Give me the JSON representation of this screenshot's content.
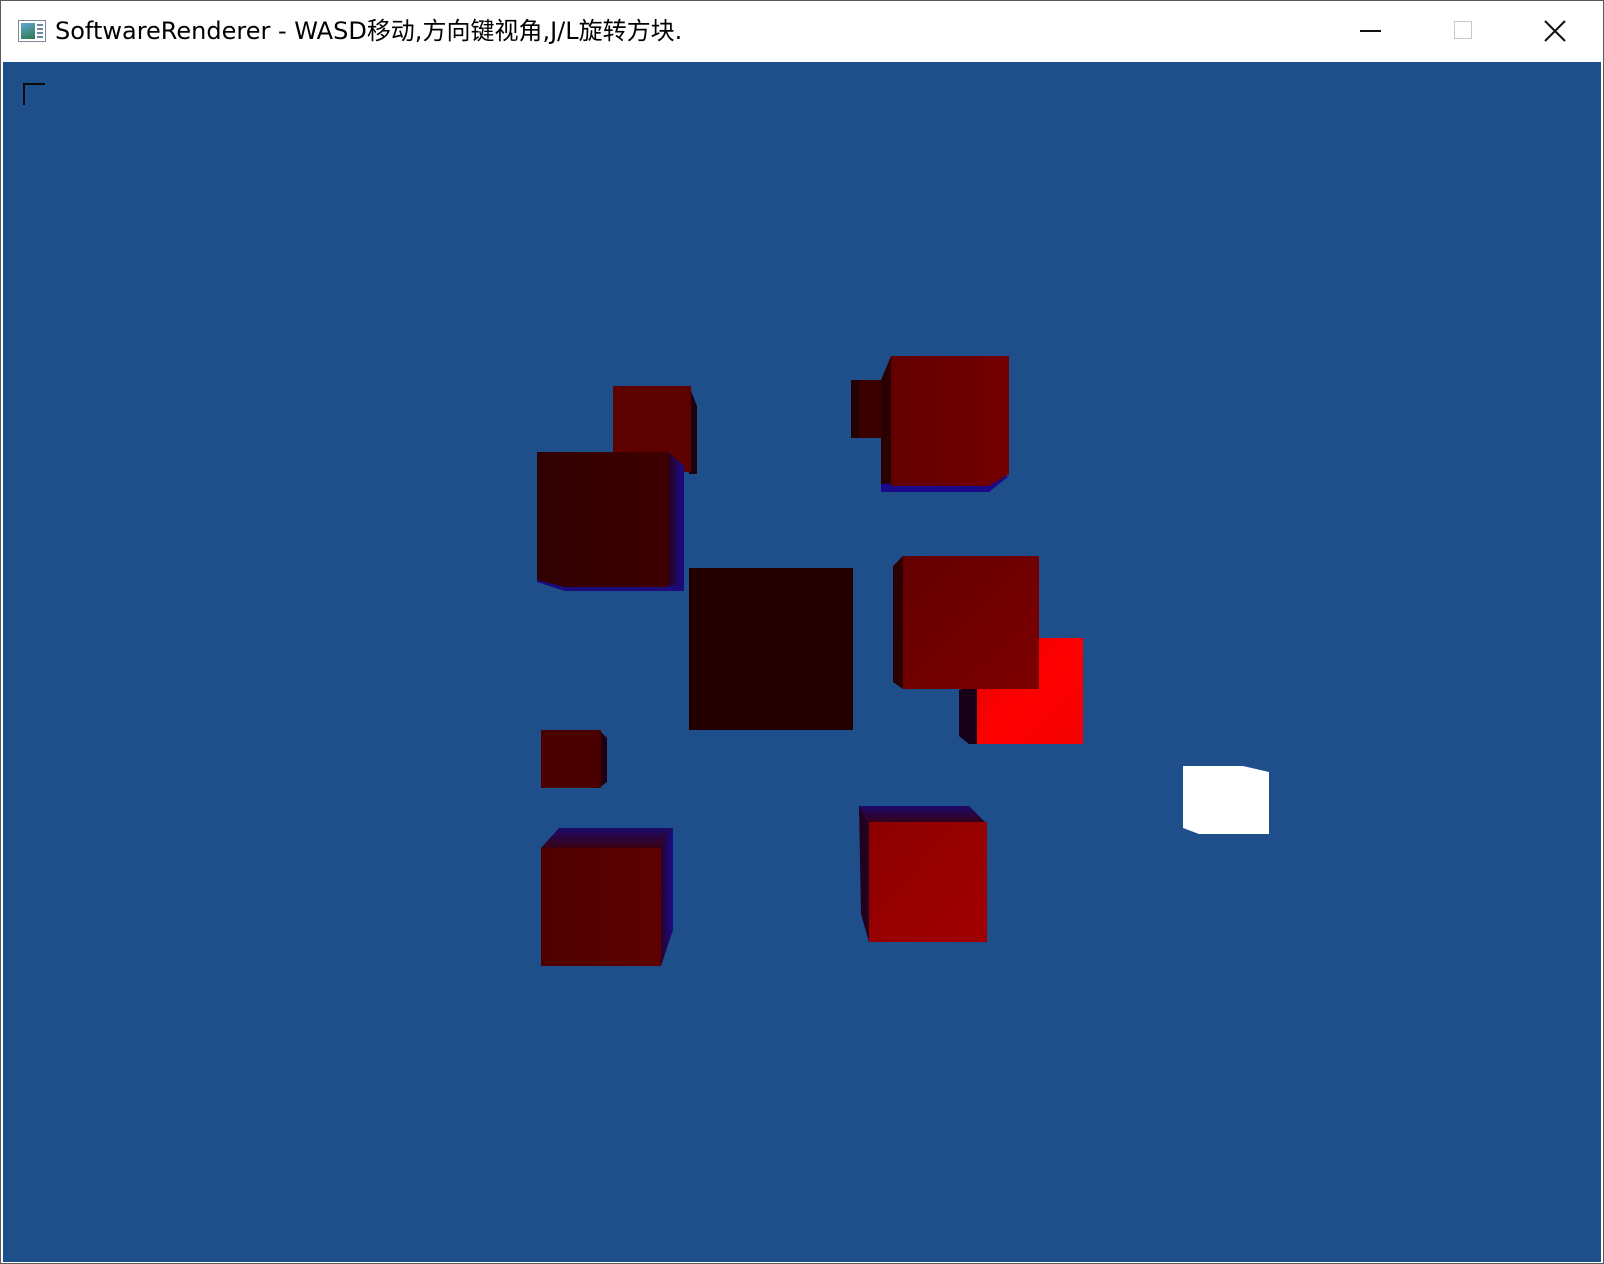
{
  "window": {
    "title": "SoftwareRenderer - WASD移动,方向键视角,J/L旋转方块.",
    "controls": [
      "minimize-icon",
      "maximize-icon",
      "close-icon"
    ]
  },
  "viewport": {
    "background_color": "#1f4f8a",
    "cursor_marker": "corner-bracket-icon"
  },
  "scene": {
    "objects": [
      {
        "name": "cube-upper-left-back",
        "color": "#5c0000"
      },
      {
        "name": "cube-upper-left-front",
        "color": "#360000"
      },
      {
        "name": "cube-upper-right-small",
        "color": "#3a0000"
      },
      {
        "name": "cube-upper-right",
        "color": "#6c0000"
      },
      {
        "name": "cube-center",
        "color": "#220000"
      },
      {
        "name": "cube-right-middle-bright",
        "color": "#ff0000"
      },
      {
        "name": "cube-right-middle",
        "color": "#6e0000"
      },
      {
        "name": "cube-left-small",
        "color": "#4a0000"
      },
      {
        "name": "cube-lower-left",
        "color": "#560000"
      },
      {
        "name": "cube-lower-middle",
        "color": "#9a0000"
      },
      {
        "name": "cube-white-light",
        "color": "#ffffff"
      }
    ]
  }
}
